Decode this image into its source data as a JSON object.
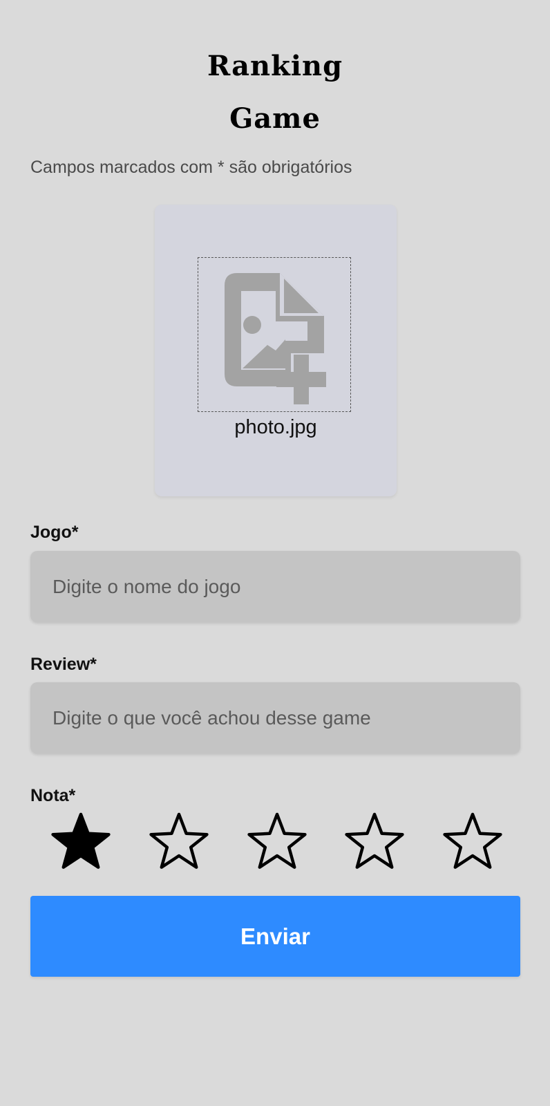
{
  "header": {
    "title_line1": "Ranking",
    "title_line2": "Game"
  },
  "hint": "Campos marcados com * são obrigatórios",
  "photo": {
    "icon": "add-photo-file-icon",
    "filename": "photo.jpg"
  },
  "form": {
    "game_label": "Jogo*",
    "game_placeholder": "Digite o nome do jogo",
    "game_value": "",
    "review_label": "Review*",
    "review_placeholder": "Digite o que você achou desse game",
    "review_value": "",
    "rating_label": "Nota*",
    "rating": 1,
    "rating_max": 5
  },
  "submit_label": "Enviar",
  "colors": {
    "background": "#dadada",
    "photo_card": "#d4d5de",
    "input_bg": "#c4c4c4",
    "accent": "#2e8bff"
  }
}
